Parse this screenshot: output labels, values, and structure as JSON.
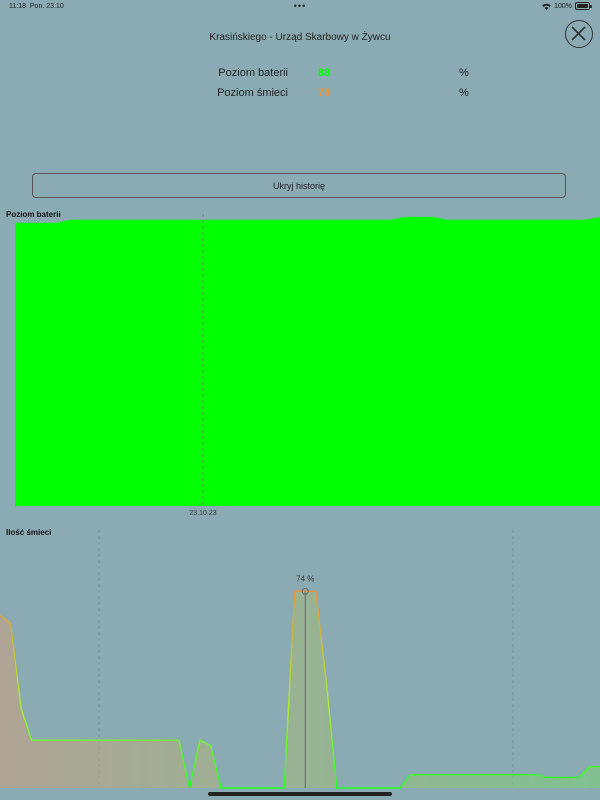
{
  "status_bar": {
    "time": "11:18",
    "date": "Pon. 23.10",
    "dots": "•••",
    "wifi": "wifi",
    "battery_text": "100%"
  },
  "header": {
    "title": "Krasińskiego - Urząd Skarbowy w Żywcu",
    "close_icon": "close-icon"
  },
  "metrics": [
    {
      "label": "Poziom baterii",
      "value": "88",
      "unit": "%",
      "color": "#00ff00"
    },
    {
      "label": "Poziom śmieci",
      "value": "78",
      "unit": "%",
      "color": "#e8953a"
    }
  ],
  "history_button": {
    "label": "Ukryj historię"
  },
  "colors": {
    "background": "#8aabb4",
    "battery_fill": "#00ff00",
    "waste_high": "#e8953a",
    "waste_low": "#22ff22"
  },
  "chart_data": [
    {
      "type": "area",
      "title": "Poziom baterii",
      "x_tick_labels": [
        "23.10.23"
      ],
      "ylim": [
        0,
        100
      ],
      "values": [
        97,
        97,
        97,
        97,
        98,
        98,
        98,
        98,
        98,
        98,
        98,
        98,
        98,
        98,
        98,
        98,
        98,
        98,
        98,
        98,
        98,
        98,
        98,
        98,
        98,
        98,
        98,
        98,
        99,
        99,
        99,
        98,
        98,
        98,
        98,
        98,
        98,
        98,
        98,
        98,
        98,
        98,
        99
      ]
    },
    {
      "type": "area",
      "title": "Ilość śmieci",
      "annotation": "74 %",
      "ylim": [
        0,
        100
      ],
      "values": [
        65,
        62,
        30,
        18,
        18,
        18,
        18,
        18,
        18,
        18,
        18,
        18,
        18,
        18,
        18,
        18,
        18,
        18,
        0,
        18,
        16,
        0,
        0,
        0,
        0,
        0,
        0,
        0,
        74,
        74,
        74,
        40,
        0,
        0,
        0,
        0,
        0,
        0,
        0,
        5,
        5,
        5,
        5,
        5,
        5,
        5,
        5,
        5,
        5,
        5,
        5,
        5,
        4,
        4,
        4,
        4,
        8,
        8
      ]
    }
  ]
}
